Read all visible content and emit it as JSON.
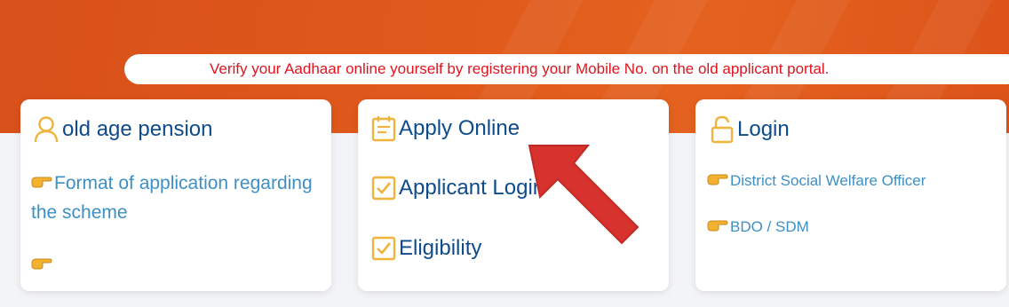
{
  "marquee": {
    "text": "Verify your Aadhaar online yourself by registering your Mobile No. on the old applicant portal."
  },
  "cards": {
    "pension": {
      "title": "old age pension",
      "links": [
        "Format of application regarding the scheme",
        ""
      ]
    },
    "apply": {
      "items": [
        "Apply Online",
        "Applicant Login",
        "Eligibility"
      ]
    },
    "login": {
      "title": "Login",
      "links": [
        "District Social Welfare Officer",
        "BDO / SDM"
      ]
    }
  },
  "colors": {
    "hero": "#e05a1c",
    "marquee_text": "#e0141e",
    "title": "#0d4b8c",
    "link": "#3d8fc4",
    "icon": "#f0b43c",
    "annotation_arrow": "#d7322d"
  },
  "icons": {
    "pension": "user-icon",
    "apply_online": "calendar-icon",
    "applicant_login": "checkbox-icon",
    "eligibility": "checkbox-icon",
    "login": "unlock-icon",
    "link_bullet": "pointing-hand-icon"
  }
}
